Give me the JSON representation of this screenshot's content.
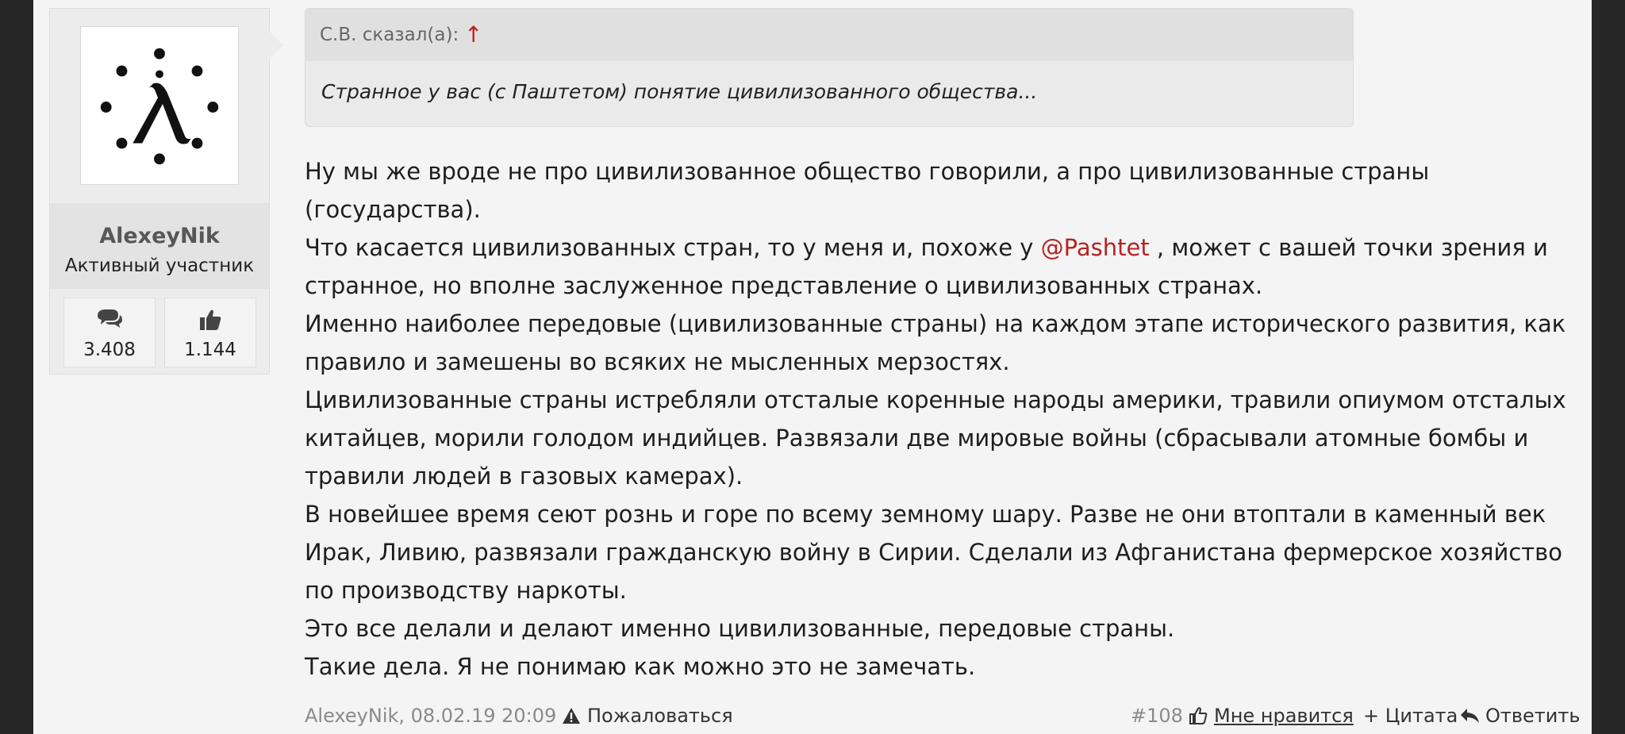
{
  "user": {
    "name": "AlexeyNik",
    "title": "Активный участник",
    "messages_count": "3.408",
    "likes_count": "1.144"
  },
  "quote": {
    "author": "С.В. сказал(а):",
    "arrow": "↑",
    "text": "Странное у вас (с Паштетом) понятие цивилизованного общества..."
  },
  "post": {
    "paragraphs": [
      "Ну мы же вроде не про цивилизованное общество говорили, а про цивилизованные страны (государства).",
      "Именно наиболее передовые (цивилизованные страны) на каждом этапе исторического развития, как правило и замешены во всяких не мысленных мерзостях.",
      "Цивилизованные страны истребляли отсталые коренные народы америки, травили опиумом отсталых китайцев, морили голодом индийцев. Развязали две мировые войны (сбрасывали атомные бомбы и травили людей в газовых камерах).",
      "В новейшее время сеют рознь и горе по всему земному шару. Разве не они втоптали в каменный век Ирак, Ливию, развязали гражданскую войну в Сирии. Сделали из Афганистана фермерское хозяйство по производству наркоты.",
      "Это все делали и делают именно цивилизованные, передовые страны.",
      "Такие дела. Я не понимаю как можно это не замечать."
    ],
    "mention_line_before": "Что касается цивилизованных стран, то у меня и, похоже у ",
    "mention": "@Pashtet",
    "mention_line_after": " , может с вашей точки зрения и странное, но вполне заслуженное представление о цивилизованных странах."
  },
  "footer": {
    "meta": "AlexeyNik, 08.02.19 20:09",
    "report": "Пожаловаться",
    "post_number": "#108",
    "like": "Мне нравится",
    "quote": "+ Цитата",
    "reply": "Ответить"
  },
  "icons": {
    "messages": "comments-icon",
    "likes": "thumbs-up-icon",
    "report": "warning-icon",
    "like": "thumbs-up-outline-icon",
    "reply": "reply-icon"
  },
  "colors": {
    "mention": "#b52323",
    "quote_arrow": "#c02020",
    "background": "#262626",
    "page": "#f4f4f4"
  }
}
